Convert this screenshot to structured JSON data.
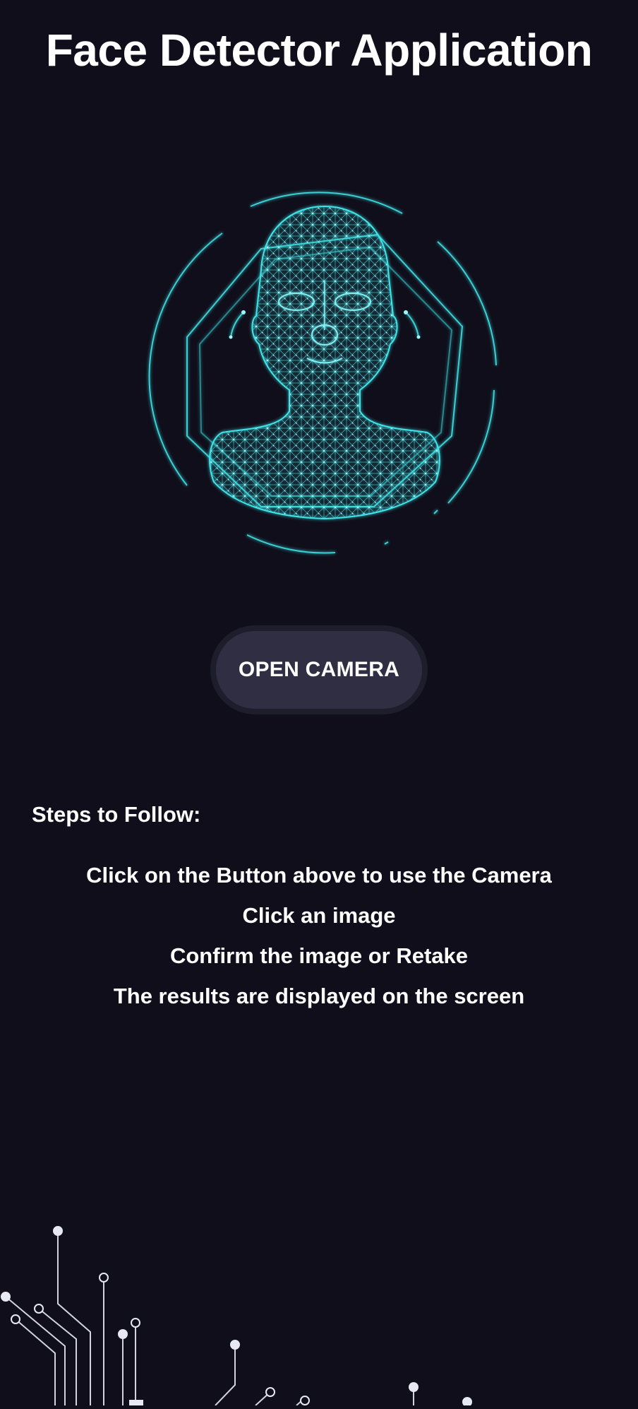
{
  "app": {
    "title": "Face Detector Application"
  },
  "hero": {
    "icon": "face-mesh-scan-icon",
    "accent_color": "#3fe3e8"
  },
  "camera_button": {
    "label": "OPEN CAMERA"
  },
  "steps": {
    "heading": "Steps to Follow:",
    "items": [
      "Click on the Button above to use the Camera",
      "Click an image",
      "Confirm the image or Retake",
      "The results are displayed on the screen"
    ]
  },
  "decoration": {
    "icon": "circuit-lines-icon"
  },
  "colors": {
    "background": "#0f0e1a",
    "button_background": "#2f2e42",
    "text": "#ffffff"
  }
}
